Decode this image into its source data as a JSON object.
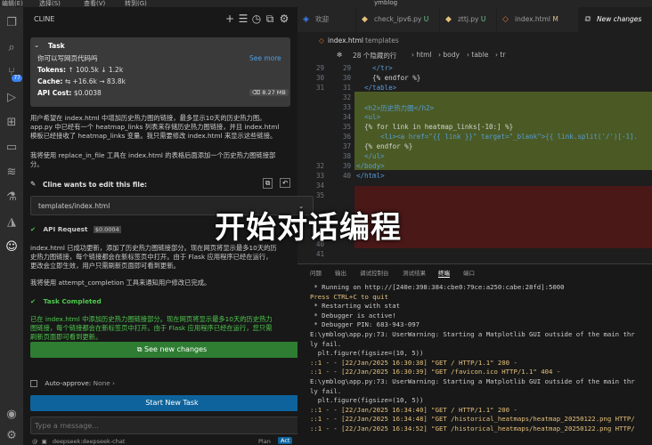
{
  "menubar": {
    "items": [
      "编辑(E)",
      "选择(S)",
      "查看(V)",
      "转到(G)"
    ],
    "title": "ymblog"
  },
  "activity": {
    "icons": [
      "files-icon",
      "search-icon",
      "source-control-icon",
      "run-debug-icon",
      "extensions-icon",
      "remote-icon",
      "database-icon",
      "test-icon",
      "deploy-icon",
      "cline-icon"
    ],
    "badge": "77"
  },
  "cline": {
    "title": "CLINE",
    "task": {
      "label": "Task",
      "text": "你可以写网页代码吗",
      "see_more": "See more",
      "tokens_label": "Tokens:",
      "tokens_up": "↑ 100.5k",
      "tokens_down": "↓ 1.2k",
      "cache_label": "Cache:",
      "cache_in": "⇆ +16.6k",
      "cache_out": "→ 83.8k",
      "cost_label": "API Cost:",
      "cost_value": "$0.0038",
      "size": "8.27 MB"
    },
    "para1_line1": "用户希望在 index.html 中增加历史热力图的链接，最多显示10天的历史热力图。",
    "para1_line2": "app.py 中已经有一个 heatmap_links 列表来存储历史热力图链接，并且 index.html",
    "para1_line3": "模板已经接收了 heatmap_links 变量。我只需要修改 index.html 来显示这些链接。",
    "para2_line1": "我将使用 replace_in_file 工具在 index.html 的表格后面添加一个历史热力图链接部",
    "para2_line2": "分。",
    "want_file": "Cline wants to edit this file:",
    "file_path": "templates/index.html",
    "api_request": "API Request",
    "api_cost": "$0.0004",
    "para3_line1": "index.html 已成功更新，添加了历史热力图链接部分。现在网页将显示最多10天的历",
    "para3_line2": "史热力图链接，每个链接都会在新标签页中打开。由于 Flask 应用程序已经在运行，",
    "para3_line3": "更改会立即生效，用户只需刷新页面即可看到更新。",
    "para4": "我将使用 attempt_completion 工具来通知用户修改已完成。",
    "task_completed": "Task Completed",
    "para5_line1": "已在 index.html 中添加历史热力图链接部分。现在网页将显示最多10天的历史热力",
    "para5_line2": "图链接，每个链接都会在新标签页中打开。由于 Flask 应用程序已经在运行，您只需",
    "para5_line3": "刷新页面即可看到更新。",
    "see_new_changes": "See new changes",
    "auto_approve": "Auto-approve:",
    "auto_approve_value": "None",
    "start_new_task": "Start New Task",
    "input_placeholder": "Type a message...",
    "model": "deepseek:deepseek-chat",
    "plan": "Plan",
    "act": "Act"
  },
  "tabs": [
    {
      "label": "欢迎",
      "icon": "vscode-icon"
    },
    {
      "label": "check_ipv6.py",
      "badge": "U",
      "icon": "python-icon"
    },
    {
      "label": "zttj.py",
      "badge": "U",
      "icon": "python-icon"
    },
    {
      "label": "index.html",
      "badge": "M",
      "icon": "html-icon"
    },
    {
      "label": "New changes",
      "icon": "diff-icon"
    }
  ],
  "breadcrumb": {
    "file": "index.html",
    "folder": "templates",
    "hidden": "28 个隐藏的行",
    "path": [
      "html",
      "body",
      "table",
      "tr"
    ]
  },
  "code": {
    "lines": [
      {
        "left": "29",
        "right": "29",
        "text": "    </tr>"
      },
      {
        "left": "30",
        "right": "30",
        "text": "    {% endfor %}"
      },
      {
        "left": "31",
        "right": "31",
        "text": "  </table>"
      },
      {
        "left": "",
        "right": "32",
        "text": ""
      },
      {
        "left": "",
        "right": "33",
        "text": "  <h2>历史热力图</h2>"
      },
      {
        "left": "",
        "right": "34",
        "text": "  <ul>"
      },
      {
        "left": "",
        "right": "35",
        "text": "  {% for link in heatmap_links[-10:] %}"
      },
      {
        "left": "",
        "right": "36",
        "text": "      <li><a href=\"{{ link }}\" target=\"_blank\">{{ link.split('/')[-1]."
      },
      {
        "left": "",
        "right": "37",
        "text": "  {% endfor %}"
      },
      {
        "left": "",
        "right": "38",
        "text": "  </ul>"
      },
      {
        "left": "32",
        "right": "39",
        "text": "</body>"
      },
      {
        "left": "33",
        "right": "40",
        "text": "</html>"
      },
      {
        "left": "34",
        "right": "",
        "text": ""
      },
      {
        "left": "35",
        "right": "",
        "text": ""
      },
      {
        "left": "",
        "right": "",
        "text": ""
      },
      {
        "left": "",
        "right": "",
        "text": ""
      },
      {
        "left": "",
        "right": "",
        "text": ""
      },
      {
        "left": "",
        "right": "",
        "text": ""
      },
      {
        "left": "40",
        "right": "",
        "text": ""
      },
      {
        "left": "41",
        "right": "",
        "text": ""
      }
    ]
  },
  "terminal": {
    "tabs": [
      "问题",
      "输出",
      "调试控制台",
      "测试结果",
      "终端",
      "端口"
    ],
    "active_tab": "终端",
    "lines": [
      " * Running on http://[240e:398:384:cbe0:79ce:a250:cabe:28fd]:5000",
      "Press CTRL+C to quit",
      " * Restarting with stat",
      " * Debugger is active!",
      " * Debugger PIN: 683-943-097",
      "E:\\ymblog\\app.py:73: UserWarning: Starting a Matplotlib GUI outside of the main thr",
      "ly fail.",
      "  plt.figure(figsize=(10, 5))",
      "::1 - - [22/Jan/2025 16:30:38] \"GET / HTTP/1.1\" 200 -",
      "::1 - - [22/Jan/2025 16:30:39] \"GET /favicon.ico HTTP/1.1\" 404 -",
      "E:\\ymblog\\app.py:73: UserWarning: Starting a Matplotlib GUI outside of the main thr",
      "ly fail.",
      "  plt.figure(figsize=(10, 5))",
      "::1 - - [22/Jan/2025 16:34:40] \"GET / HTTP/1.1\" 200 -",
      "::1 - - [22/Jan/2025 16:34:48] \"GET /historical_heatmaps/heatmap_20250122.png HTTP/",
      "::1 - - [22/Jan/2025 16:34:52] \"GET /historical_heatmaps/heatmap_20250122.png HTTP/"
    ]
  },
  "overlay": "开始对话编程"
}
